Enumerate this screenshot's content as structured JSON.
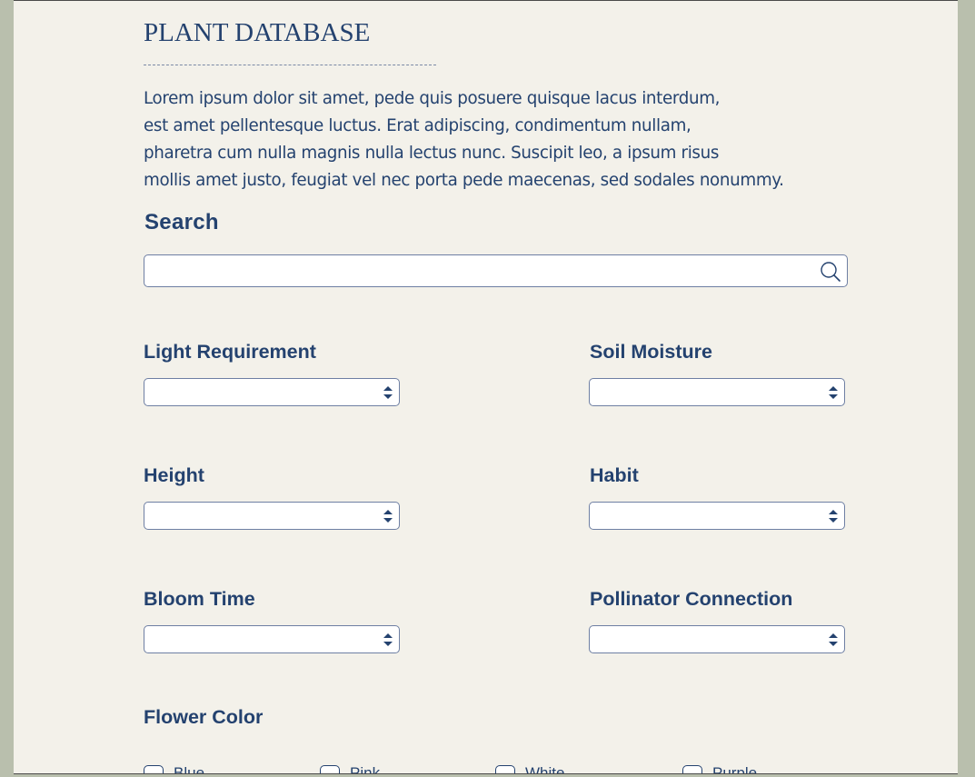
{
  "header": {
    "title": "PLANT DATABASE",
    "intro_lines": [
      "Lorem ipsum dolor sit amet, pede quis posuere quisque lacus interdum,",
      "est amet pellentesque luctus. Erat adipiscing, condimentum nullam,",
      "pharetra cum nulla magnis nulla lectus nunc. Suscipit leo, a ipsum risus",
      "mollis amet justo, feugiat vel nec porta pede maecenas, sed sodales nonummy."
    ]
  },
  "search": {
    "label": "Search",
    "value": "",
    "placeholder": "",
    "icon": "search-icon"
  },
  "filters": {
    "light_requirement": {
      "label": "Light Requirement",
      "selected": ""
    },
    "soil_moisture": {
      "label": "Soil Moisture",
      "selected": ""
    },
    "height": {
      "label": "Height",
      "selected": ""
    },
    "habit": {
      "label": "Habit",
      "selected": ""
    },
    "bloom_time": {
      "label": "Bloom Time",
      "selected": ""
    },
    "pollinator_connection": {
      "label": "Pollinator Connection",
      "selected": ""
    }
  },
  "flower_color": {
    "label": "Flower Color",
    "options": [
      {
        "label": "Blue",
        "checked": false
      },
      {
        "label": "Pink",
        "checked": false
      },
      {
        "label": "White",
        "checked": false
      },
      {
        "label": "Purple",
        "checked": false
      }
    ]
  },
  "colors": {
    "text": "#24426f",
    "paper": "#f3f1ea",
    "frame": "#b9bfad",
    "border": "#6e7fa3"
  }
}
